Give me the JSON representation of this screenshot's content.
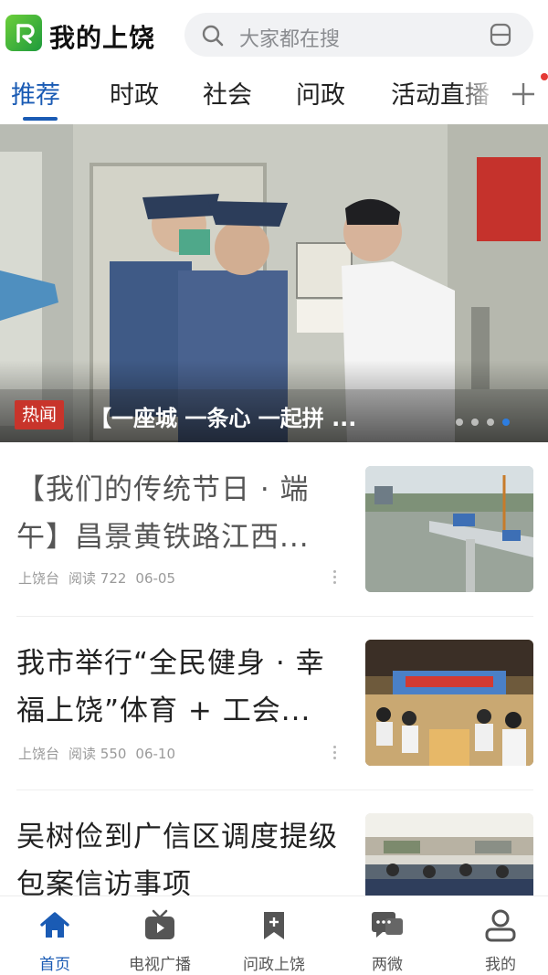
{
  "header": {
    "app_title": "我的上饶",
    "search_placeholder": "大家都在搜"
  },
  "tabs": [
    {
      "label": "推荐",
      "active": true
    },
    {
      "label": "时政",
      "active": false
    },
    {
      "label": "社会",
      "active": false
    },
    {
      "label": "问政",
      "active": false
    },
    {
      "label": "活动直播",
      "active": false
    }
  ],
  "banner": {
    "badge": "热闻",
    "title": "【一座城 一条心 一起拼 ...",
    "slide_count": 4,
    "active_slide": 4
  },
  "feed": [
    {
      "title": "【我们的传统节日 · 端午】昌景黄铁路江西...",
      "source": "上饶台",
      "reads": "阅读 722",
      "date": "06-05"
    },
    {
      "title": "我市举行“全民健身 · 幸福上饶”体育 + 工会...",
      "source": "上饶台",
      "reads": "阅读 550",
      "date": "06-10"
    },
    {
      "title": "吴树俭到广信区调度提级包案信访事项",
      "source": "",
      "reads": "",
      "date": ""
    }
  ],
  "bottom_nav": [
    {
      "label": "首页",
      "icon": "home-icon",
      "active": true
    },
    {
      "label": "电视广播",
      "icon": "tv-icon",
      "active": false
    },
    {
      "label": "问政上饶",
      "icon": "bookmark-icon",
      "active": false
    },
    {
      "label": "两微",
      "icon": "chat-icon",
      "active": false
    },
    {
      "label": "我的",
      "icon": "user-icon",
      "active": false
    }
  ],
  "colors": {
    "accent": "#1a5bb4",
    "hot_badge": "#c8342b",
    "logo_green": "#2fae3e"
  }
}
